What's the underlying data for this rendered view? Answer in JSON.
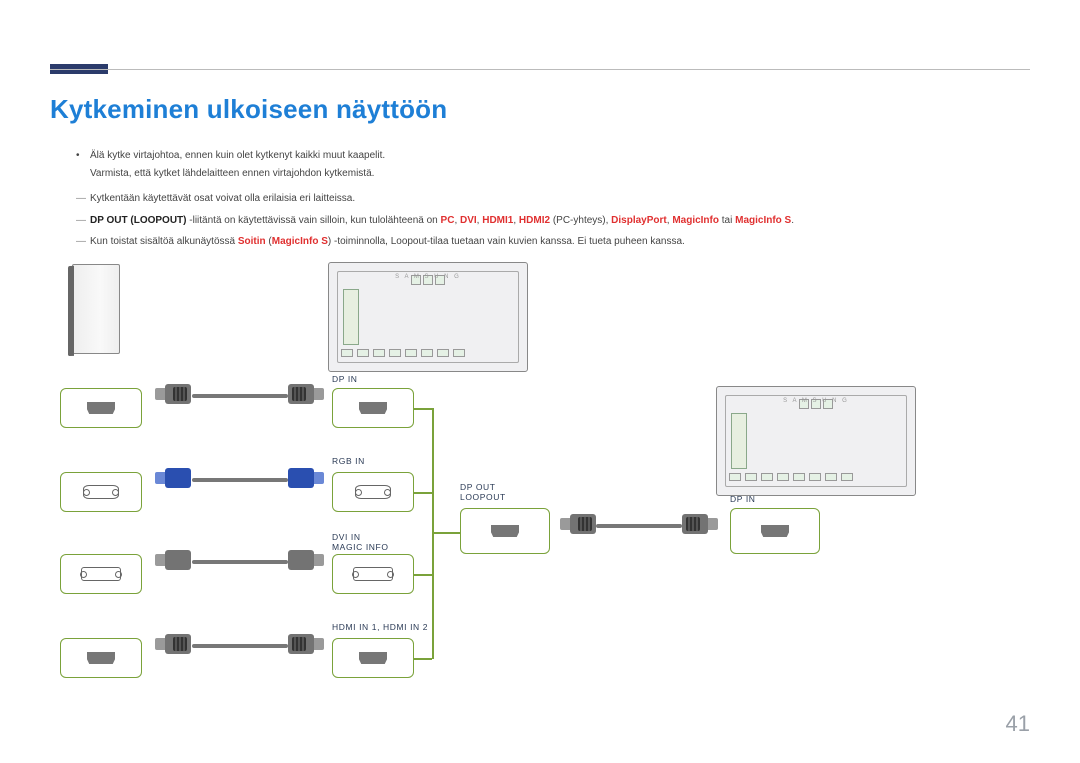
{
  "page": {
    "title": "Kytkeminen ulkoiseen näyttöön",
    "number": "41"
  },
  "bullets": {
    "b1_line1": "Älä kytke virtajohtoa, ennen kuin olet kytkenyt kaikki muut kaapelit.",
    "b1_line2": "Varmista, että kytket lähdelaitteen ennen virtajohdon kytkemistä."
  },
  "notes": {
    "n1": "Kytkentään käytettävät osat voivat olla erilaisia eri laitteissa.",
    "n2_pre": "DP OUT (LOOPOUT)",
    "n2_mid": " -liitäntä on käytettävissä vain silloin, kun tulolähteenä on ",
    "n2_list_pc": "PC",
    "n2_list_dvi": "DVI",
    "n2_list_h1": "HDMI1",
    "n2_list_h2": "HDMI2",
    "n2_paren": " (PC-yhteys), ",
    "n2_list_dp": "DisplayPort",
    "n2_list_mi": "MagicInfo",
    "n2_or": " tai ",
    "n2_list_mis": "MagicInfo S",
    "n2_end": ".",
    "n3_pre": "Kun toistat sisältöä alkunäytössä ",
    "n3_soitin": "Soitin",
    "n3_paren_open": " (",
    "n3_mis": "MagicInfo S",
    "n3_paren_close": ") ",
    "n3_rest": "-toiminnolla, Loopout-tilaa tuetaan vain kuvien kanssa. Ei tueta puheen kanssa."
  },
  "labels": {
    "dp_in": "DP IN",
    "rgb_in": "RGB IN",
    "dvi_in": "DVI IN",
    "magic_info": "MAGIC INFO",
    "hdmi_in": "HDMI IN 1, HDMI IN 2",
    "dp_out": "DP OUT",
    "loopout": "LOOPOUT",
    "dp_in_2": "DP IN"
  }
}
